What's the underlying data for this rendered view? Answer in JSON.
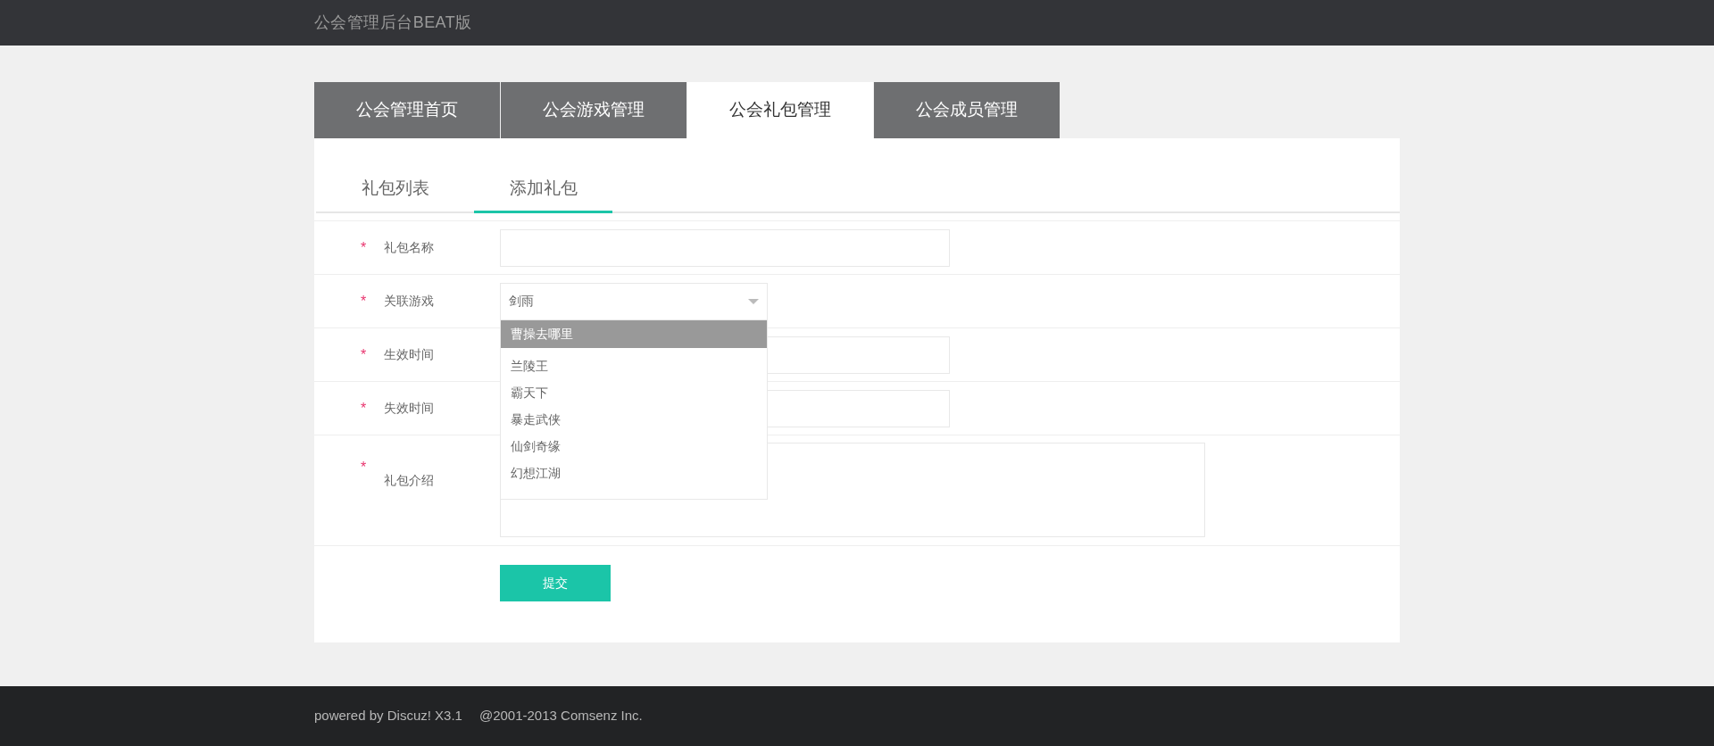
{
  "header": {
    "title": "公会管理后台BEAT版"
  },
  "tabs": [
    {
      "label": "公会管理首页",
      "selected": false
    },
    {
      "label": "公会游戏管理",
      "selected": false
    },
    {
      "label": "公会礼包管理",
      "selected": true
    },
    {
      "label": "公会成员管理",
      "selected": false
    }
  ],
  "subtabs": [
    {
      "label": "礼包列表",
      "selected": false
    },
    {
      "label": "添加礼包",
      "selected": true
    }
  ],
  "form": {
    "fields": [
      {
        "kind": "text",
        "label": "礼包名称",
        "required_mark": "*"
      },
      {
        "kind": "select",
        "label": "关联游戏",
        "required_mark": "*",
        "value": "剑雨",
        "expanded": true,
        "options": [
          {
            "label": "曹操去哪里",
            "selected": true
          },
          {
            "label": "兰陵王",
            "selected": false
          },
          {
            "label": "霸天下",
            "selected": false
          },
          {
            "label": "暴走武侠",
            "selected": false
          },
          {
            "label": "仙剑奇缘",
            "selected": false
          },
          {
            "label": "幻想江湖",
            "selected": false
          }
        ]
      },
      {
        "kind": "text",
        "label": "生效时间",
        "required_mark": "*"
      },
      {
        "kind": "text",
        "label": "失效时间",
        "required_mark": "*"
      },
      {
        "kind": "textarea",
        "label": "礼包介绍",
        "required_mark": "*"
      }
    ],
    "submit": "提交"
  },
  "footer": [
    "powered by Discuz! X3.1",
    "@2001-2013 Comsenz Inc."
  ]
}
